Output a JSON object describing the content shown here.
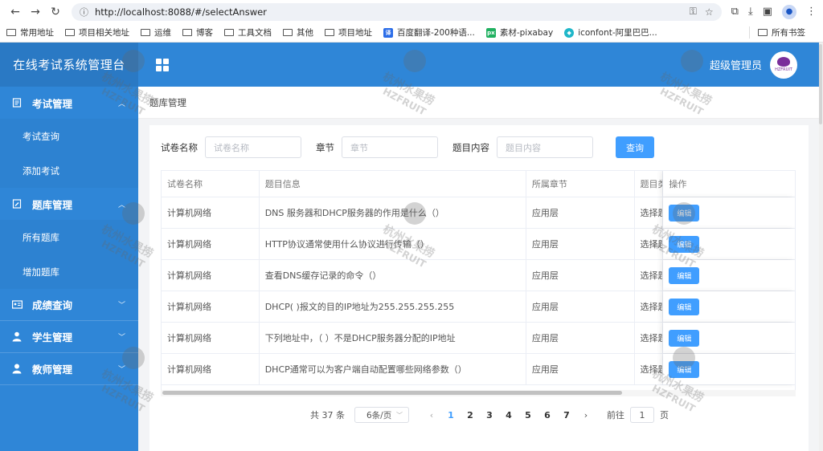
{
  "browser": {
    "url": "http://localhost:8088/#/selectAnswer",
    "bookmarks": [
      "常用地址",
      "项目相关地址",
      "运维",
      "博客",
      "工具文档",
      "其他",
      "项目地址",
      "百度翻译-200种语...",
      "素材-pixabay",
      "iconfont-阿里巴巴..."
    ],
    "bookmarks_right": "所有书签"
  },
  "header": {
    "app_title": "在线考试系统管理台",
    "user_name": "超级管理员"
  },
  "sidebar": {
    "groups": [
      {
        "label": "考试管理",
        "children": [
          "考试查询",
          "添加考试"
        ]
      },
      {
        "label": "题库管理",
        "children": [
          "所有题库",
          "增加题库"
        ]
      },
      {
        "label": "成绩查询"
      },
      {
        "label": "学生管理"
      },
      {
        "label": "教师管理"
      }
    ]
  },
  "breadcrumb": "题库管理",
  "filters": {
    "paper_label": "试卷名称",
    "paper_placeholder": "试卷名称",
    "section_label": "章节",
    "section_placeholder": "章节",
    "content_label": "题目内容",
    "content_placeholder": "题目内容",
    "query_button": "查询"
  },
  "table": {
    "headers": [
      "试卷名称",
      "题目信息",
      "所属章节",
      "题目类",
      "操作"
    ],
    "edit_label": "编辑",
    "rows": [
      {
        "paper": "计算机网络",
        "question": "DNS 服务器和DHCP服务器的作用是什么（）",
        "section": "应用层",
        "type": "选择题"
      },
      {
        "paper": "计算机网络",
        "question": "HTTP协议通常使用什么协议进行传输（）",
        "section": "应用层",
        "type": "选择题"
      },
      {
        "paper": "计算机网络",
        "question": "查看DNS缓存记录的命令（）",
        "section": "应用层",
        "type": "选择题"
      },
      {
        "paper": "计算机网络",
        "question": "DHCP( )报文的目的IP地址为255.255.255.255",
        "section": "应用层",
        "type": "选择题"
      },
      {
        "paper": "计算机网络",
        "question": "下列地址中，（ ）不是DHCP服务器分配的IP地址",
        "section": "应用层",
        "type": "选择题"
      },
      {
        "paper": "计算机网络",
        "question": "DHCP通常可以为客户端自动配置哪些网络参数（）",
        "section": "应用层",
        "type": "选择题"
      }
    ]
  },
  "pagination": {
    "total": "共 37 条",
    "page_size": "6条/页",
    "pages": [
      "1",
      "2",
      "3",
      "4",
      "5",
      "6",
      "7"
    ],
    "current": "1",
    "goto_label": "前往",
    "goto_value": "1",
    "goto_suffix": "页"
  },
  "watermark": {
    "line1": "杭州水果捞",
    "line2": "HZFRUIT"
  },
  "colors": {
    "header_blue": "#2f86d7",
    "primary": "#409eff"
  }
}
